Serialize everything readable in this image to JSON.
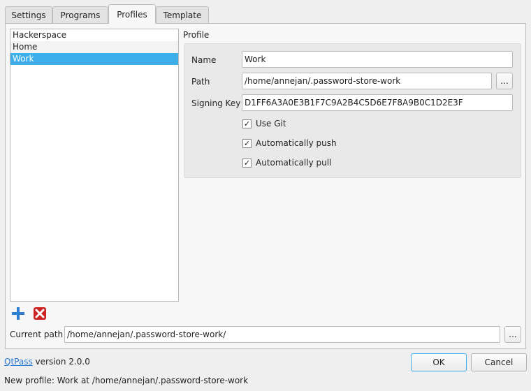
{
  "tabs": [
    {
      "label": "Settings"
    },
    {
      "label": "Programs"
    },
    {
      "label": "Profiles",
      "active": true
    },
    {
      "label": "Template"
    }
  ],
  "profiles": {
    "items": [
      "Hackerspace",
      "Home",
      "Work"
    ],
    "selected": "Work",
    "add_icon": "plus-icon",
    "remove_icon": "red-x-icon"
  },
  "profile_group": {
    "title": "Profile",
    "name_label": "Name",
    "name_value": "Work",
    "path_label": "Path",
    "path_value": "/home/annejan/.password-store-work",
    "browse_label": "...",
    "signing_key_label": "Signing Key",
    "signing_key_value": "D1FF6A3A0E3B1F7C9A2B4C5D6E7F8A9B0C1D2E3F",
    "use_git_label": "Use Git",
    "use_git": true,
    "auto_push_label": "Automatically push",
    "auto_push": true,
    "auto_pull_label": "Automatically pull",
    "auto_pull": true
  },
  "current_path": {
    "label": "Current path",
    "value": "/home/annejan/.password-store-work/",
    "browse_label": "..."
  },
  "footer": {
    "app_link": "QtPass",
    "version_text": "version 2.0.0",
    "ok_label": "OK",
    "cancel_label": "Cancel",
    "status_text": "New profile: Work at /home/annejan/.password-store-work"
  },
  "colors": {
    "selection": "#3daee9",
    "link": "#2a7ad4",
    "add_icon": "#2f7fd1",
    "remove_icon": "#cc2222"
  }
}
